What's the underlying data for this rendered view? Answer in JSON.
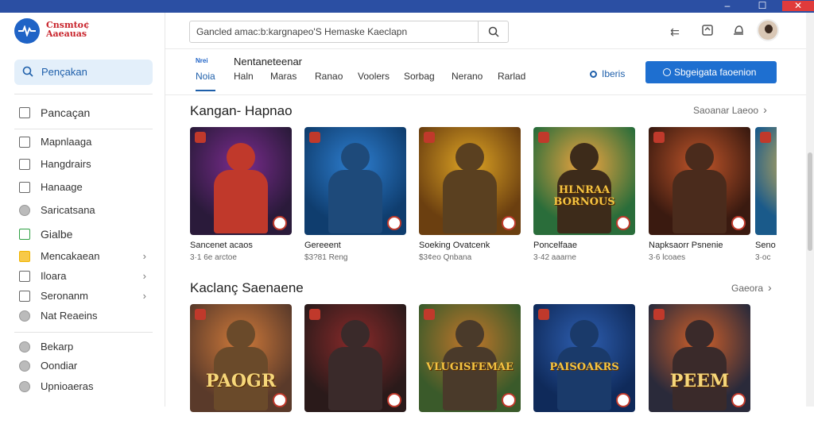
{
  "app": {
    "brand_line1": "Cnsmto¢",
    "brand_line2": "Aaeauas",
    "window_controls": {
      "minimize": "–",
      "maximize": "☐",
      "close": "✕"
    }
  },
  "sidebar": {
    "search_label": "Pençakan",
    "items": [
      {
        "label": "Pancaçan",
        "icon": "window-icon"
      },
      {
        "label": "Mapnlaaga",
        "icon": "window-icon"
      },
      {
        "label": "Hangdrairs",
        "icon": "window-icon"
      },
      {
        "label": "Hanaage",
        "icon": "window-icon"
      },
      {
        "label": "Saricatsana",
        "icon": "circle-icon"
      },
      {
        "label": "Gialbe",
        "icon": "checkbox-icon"
      },
      {
        "label": "Mencakaean",
        "icon": "folder-icon",
        "chevron": true
      },
      {
        "label": "Iloara",
        "icon": "window-icon",
        "chevron": true
      },
      {
        "label": "Seronanm",
        "icon": "window-icon",
        "chevron": true
      },
      {
        "label": "Nat Reaeins",
        "icon": "circle-icon"
      },
      {
        "label": "Bekarp",
        "icon": "circle-icon"
      },
      {
        "label": "Oondiar",
        "icon": "circle-icon"
      },
      {
        "label": "Upnioaeras",
        "icon": "circle-icon"
      }
    ]
  },
  "topbar": {
    "search_text": "Gancled amac:b:kargnapeo'S Hemaske Kaeclapn",
    "icons": [
      "arrows-icon",
      "box-icon",
      "bell-icon"
    ]
  },
  "tabs": {
    "icon_label": "Nrei",
    "heading": "Nentaneteenar",
    "items": [
      "Noia",
      "Haln",
      "Maras",
      "Ranao",
      "Voolers",
      "Sorbag",
      "Nerano",
      "Rarlad"
    ],
    "active_index": 0,
    "link_label": "Iberis",
    "primary_button": "Sbgeigata faoenion"
  },
  "sections": [
    {
      "title": "Kangan- Hapnao",
      "more": "Saoanar Laeoo",
      "cards": [
        {
          "title": "Sancenet acaos",
          "meta": "3·1 6e arctoe",
          "colors": [
            "#2a1a3a",
            "#7b2c8f",
            "#c0392b"
          ]
        },
        {
          "title": "Gereeent",
          "meta": "$3?81 Reng",
          "colors": [
            "#0f3d6e",
            "#2e7fd1",
            "#1e4a7a"
          ]
        },
        {
          "title": "Soeking Ovatcenk",
          "meta": "$3¢eo Qnbana",
          "colors": [
            "#6b3f10",
            "#e0a624",
            "#5a4020"
          ]
        },
        {
          "title": "Poncelfaae",
          "meta": "3·42 aaarne",
          "colors": [
            "#2a6d3a",
            "#f2a540",
            "#3d2b1a"
          ],
          "banner": "HLNRAA BORNOUS"
        },
        {
          "title": "Napksaorr Psnenie",
          "meta": "3·6 lcoaes",
          "colors": [
            "#3a1a10",
            "#c2562a",
            "#4a2b1c"
          ]
        },
        {
          "title": "Seno",
          "meta": "3·oc",
          "colors": [
            "#1a5a8a",
            "#f2c14a",
            "#2a7a5a"
          ]
        }
      ]
    },
    {
      "title": "Kaclanç Saenaene",
      "more": "Gaeora",
      "cards": [
        {
          "title": "",
          "meta": "",
          "colors": [
            "#5a3a2a",
            "#d07a3a",
            "#6a4a2a"
          ],
          "banner": "PAOGR"
        },
        {
          "title": "",
          "meta": "",
          "colors": [
            "#2a1a1a",
            "#8a2a2a",
            "#3a2a2a"
          ]
        },
        {
          "title": "",
          "meta": "",
          "colors": [
            "#3a5a2a",
            "#c2762a",
            "#4a3a2a"
          ],
          "banner": "VLUGISFEMAE"
        },
        {
          "title": "",
          "meta": "",
          "colors": [
            "#0f2a5a",
            "#2e5fb1",
            "#1a3a6a"
          ],
          "banner": "PAISOAKRS"
        },
        {
          "title": "",
          "meta": "",
          "colors": [
            "#2a2a3a",
            "#d0602a",
            "#3a2a2a"
          ],
          "banner": "PEEM"
        }
      ]
    }
  ]
}
